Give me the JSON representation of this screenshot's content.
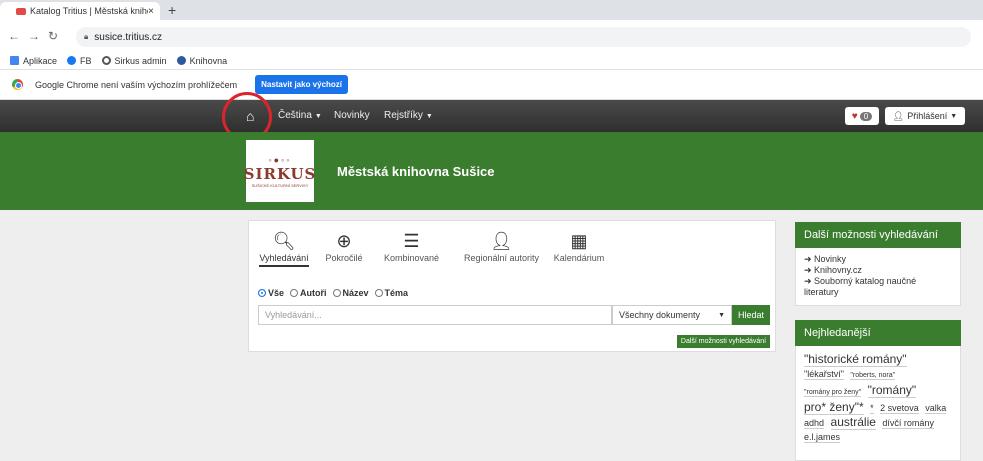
{
  "browser": {
    "tab_title": "Katalog Tritius | Městská knihovn",
    "tab_close": "×",
    "new_tab": "+",
    "url": "susice.tritius.cz",
    "bookmarks": [
      "Aplikace",
      "FB",
      "Sirkus admin",
      "Knihovna"
    ],
    "infobar_text": "Google Chrome není vaším výchozím prohlížečem",
    "infobar_button": "Nastavit jako výchozí"
  },
  "nav": {
    "language": "Čeština",
    "news": "Novinky",
    "registers": "Rejstříky",
    "cart_count": "0",
    "login": "Přihlášení"
  },
  "header": {
    "logo_text": "SIRKUS",
    "logo_sub": "SUŠICKÉ KULTURNÍ SERVISY",
    "library_name": "Městská knihovna Sušice"
  },
  "search": {
    "modes": [
      "Vyhledávání",
      "Pokročilé",
      "Kombinované",
      "Regionální autority",
      "Kalendárium"
    ],
    "scopes": [
      "Vše",
      "Autoři",
      "Název",
      "Téma"
    ],
    "placeholder": "Vyhledávání...",
    "doc_type": "Všechny dokumenty",
    "submit": "Hledat",
    "more_options": "Další možnosti vyhledávání"
  },
  "sidebar": {
    "more_title": "Další možnosti vyhledávání",
    "links": [
      "Novinky",
      "Knihovny.cz",
      "Souborný katalog naučné literatury"
    ],
    "popular_title": "Nejhledanější",
    "tags": [
      "\"historické romány\"",
      "\"lékařství\"",
      "\"roberts, nora\"",
      "\"romány pro ženy\"",
      "\"romány\"",
      "pro* ženy\"*",
      "*",
      "2 svetova",
      "valka",
      "adhd",
      "austrálie",
      "dívčí romány",
      "e.l.james"
    ]
  }
}
